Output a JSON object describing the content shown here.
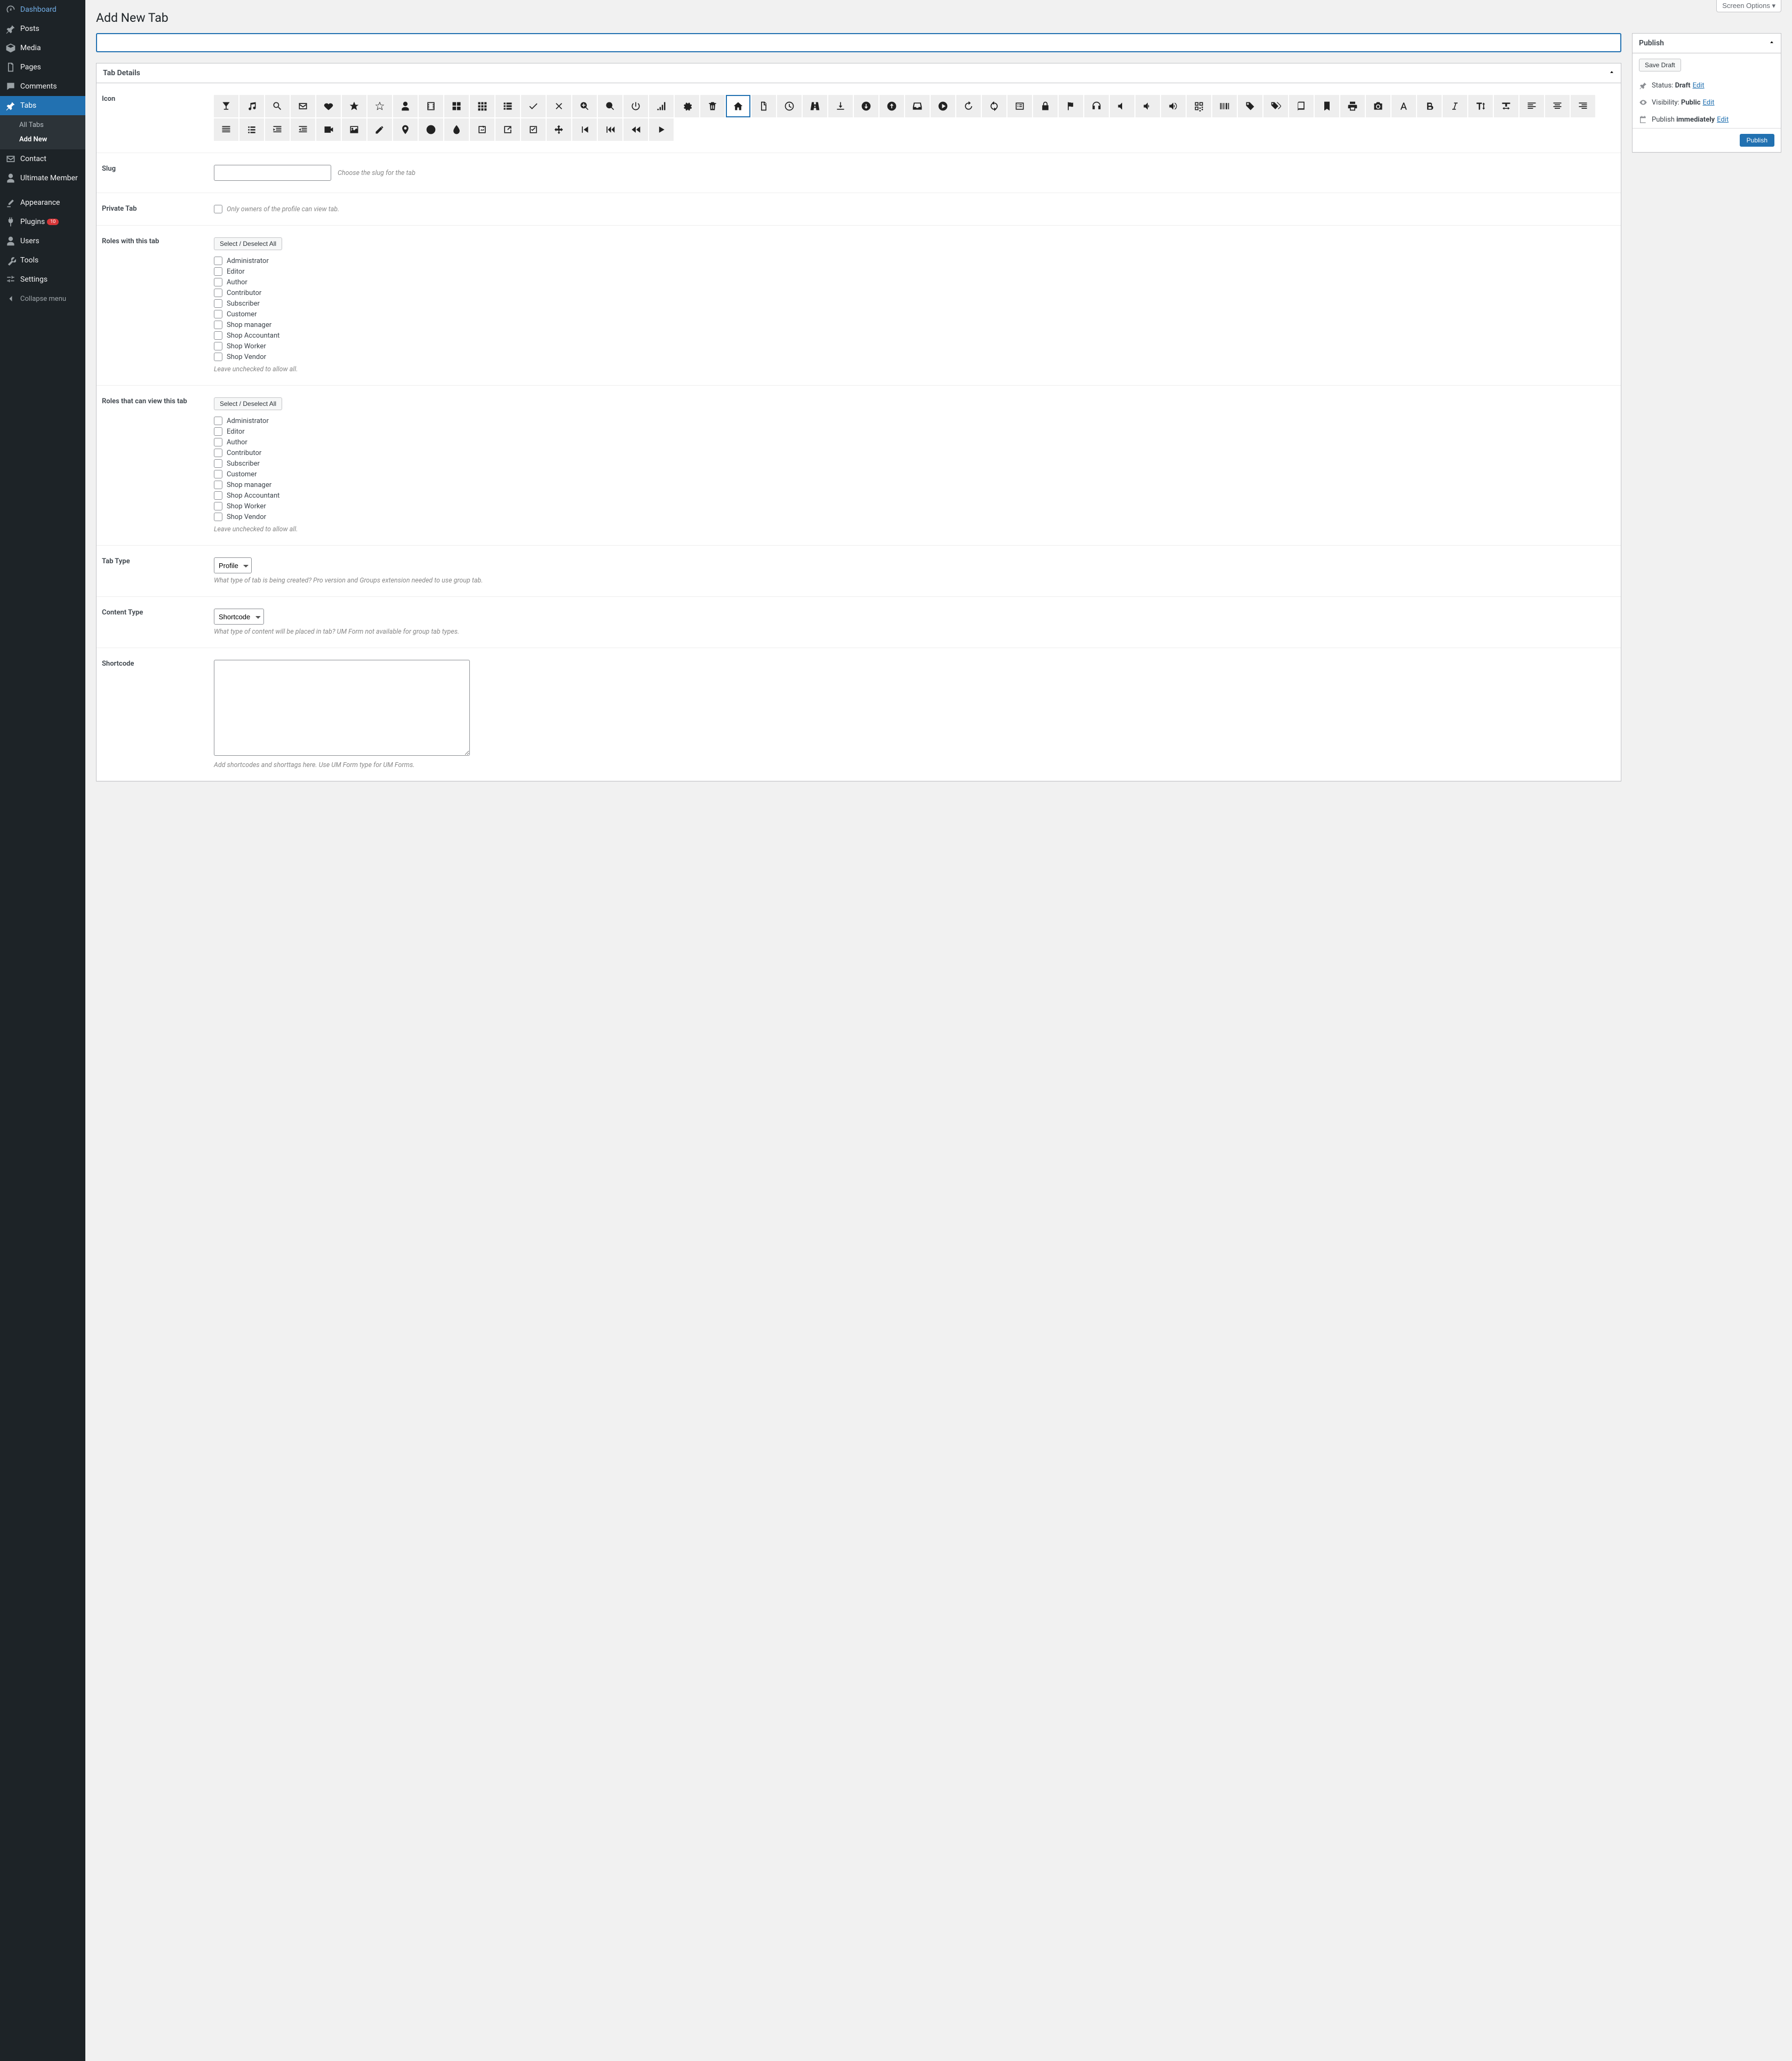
{
  "screen_options": "Screen Options ▾",
  "page_title": "Add New Tab",
  "sidebar": {
    "dashboard": "Dashboard",
    "posts": "Posts",
    "media": "Media",
    "pages": "Pages",
    "comments": "Comments",
    "tabs": "Tabs",
    "tabs_sub_all": "All Tabs",
    "tabs_sub_add": "Add New",
    "contact": "Contact",
    "ultimate_member": "Ultimate Member",
    "appearance": "Appearance",
    "plugins": "Plugins",
    "plugins_count": "10",
    "users": "Users",
    "tools": "Tools",
    "settings": "Settings",
    "collapse": "Collapse menu"
  },
  "tab_details": {
    "heading": "Tab Details",
    "icon_label": "Icon",
    "slug_label": "Slug",
    "slug_hint": "Choose the slug for the tab",
    "private_label": "Private Tab",
    "private_text": "Only owners of the profile can view tab.",
    "roles_with_label": "Roles with this tab",
    "roles_view_label": "Roles that can view this tab",
    "select_deselect": "Select / Deselect All",
    "roles": [
      "Administrator",
      "Editor",
      "Author",
      "Contributor",
      "Subscriber",
      "Customer",
      "Shop manager",
      "Shop Accountant",
      "Shop Worker",
      "Shop Vendor"
    ],
    "roles_hint": "Leave unchecked to allow all.",
    "tab_type_label": "Tab Type",
    "tab_type_value": "Profile",
    "tab_type_hint": "What type of tab is being created? Pro version and Groups extension needed to use group tab.",
    "content_type_label": "Content Type",
    "content_type_value": "Shortcode",
    "content_type_hint": "What type of content will be placed in tab? UM Form not available for group tab types.",
    "shortcode_label": "Shortcode",
    "shortcode_hint": "Add shortcodes and shorttags here. Use UM Form type for UM Forms."
  },
  "publish": {
    "heading": "Publish",
    "save_draft": "Save Draft",
    "status_label": "Status:",
    "status_value": "Draft",
    "visibility_label": "Visibility:",
    "visibility_value": "Public",
    "publish_label": "Publish",
    "publish_value": "immediately",
    "edit": "Edit",
    "publish_btn": "Publish"
  },
  "icons": [
    "glass",
    "music",
    "search",
    "envelope",
    "heart",
    "star",
    "star-o",
    "user",
    "film",
    "th-large",
    "th",
    "th-list",
    "check",
    "times",
    "search-plus",
    "search-minus",
    "power",
    "signal",
    "cog",
    "trash",
    "home",
    "file",
    "clock",
    "road",
    "download",
    "arrow-circle-down",
    "arrow-circle-up",
    "inbox",
    "play-circle",
    "repeat",
    "refresh",
    "list-alt",
    "lock",
    "flag",
    "headphones",
    "volume-off",
    "volume-down",
    "volume-up",
    "qrcode",
    "barcode",
    "tag",
    "tags",
    "book",
    "bookmark",
    "print",
    "camera",
    "font",
    "bold",
    "italic",
    "text-height",
    "text-width",
    "align-left",
    "align-center",
    "align-right",
    "align-justify",
    "list",
    "indent-left",
    "indent-right",
    "video",
    "image",
    "pencil",
    "map-marker",
    "adjust",
    "tint",
    "edit",
    "share",
    "check-square",
    "arrows",
    "step-backward",
    "fast-backward",
    "backward",
    "play"
  ],
  "selected_icon": "home"
}
